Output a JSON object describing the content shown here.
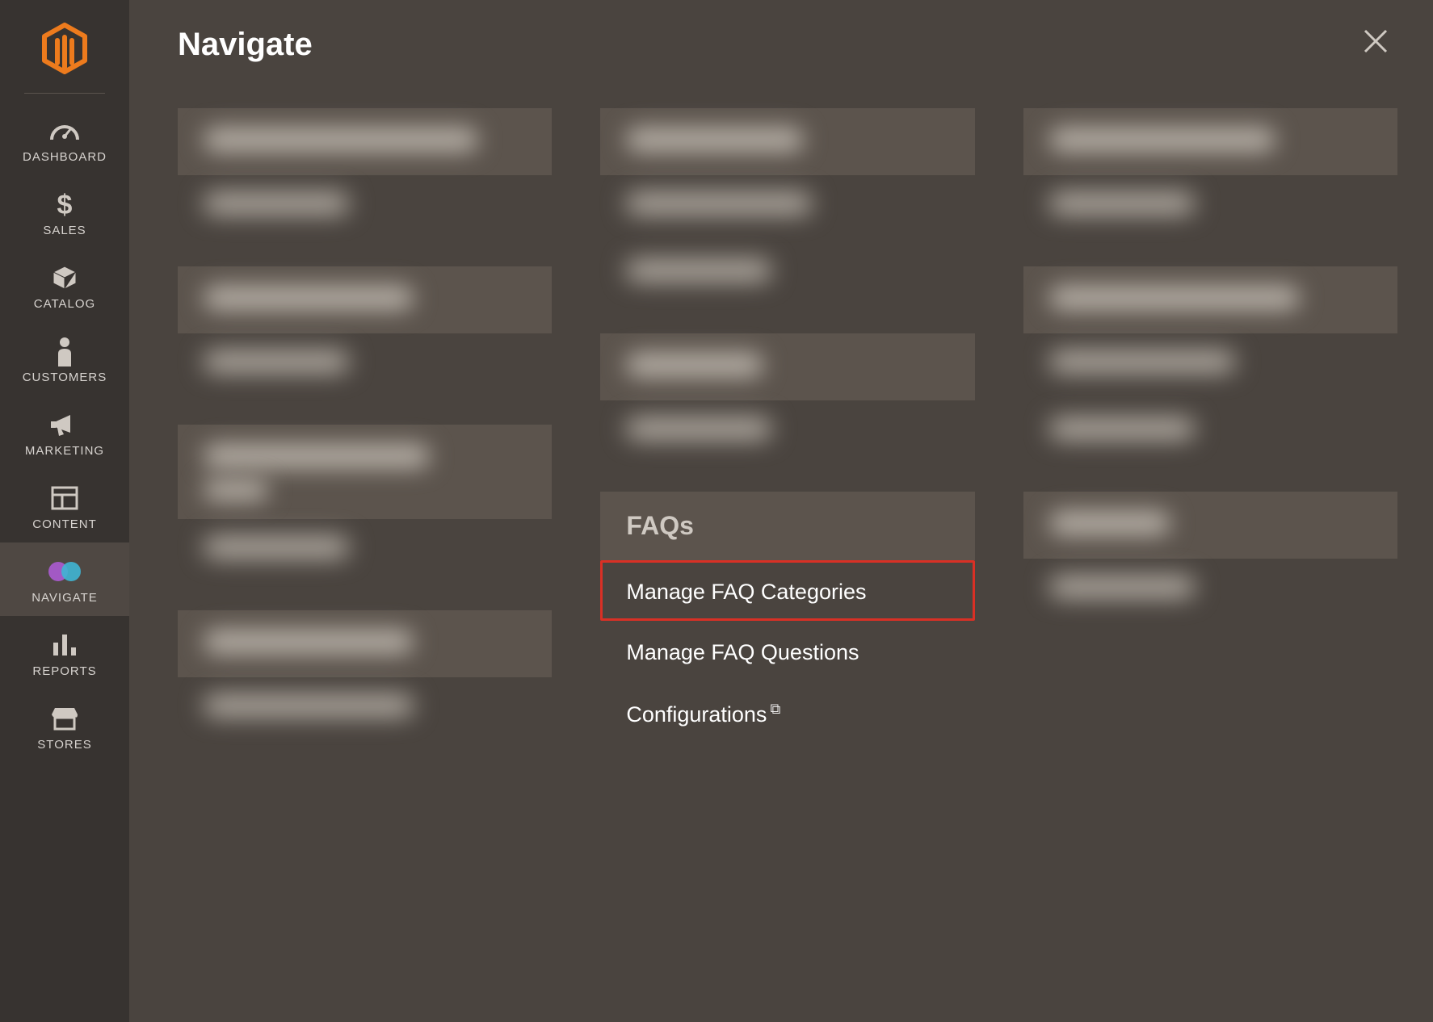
{
  "panel": {
    "title": "Navigate"
  },
  "sidebar": {
    "items": [
      {
        "label": "DASHBOARD"
      },
      {
        "label": "SALES"
      },
      {
        "label": "CATALOG"
      },
      {
        "label": "CUSTOMERS"
      },
      {
        "label": "MARKETING"
      },
      {
        "label": "CONTENT"
      },
      {
        "label": "NAVIGATE"
      },
      {
        "label": "REPORTS"
      },
      {
        "label": "STORES"
      }
    ]
  },
  "faqs": {
    "heading": "FAQs",
    "items": [
      "Manage FAQ Categories",
      "Manage FAQ Questions",
      "Configurations"
    ]
  }
}
